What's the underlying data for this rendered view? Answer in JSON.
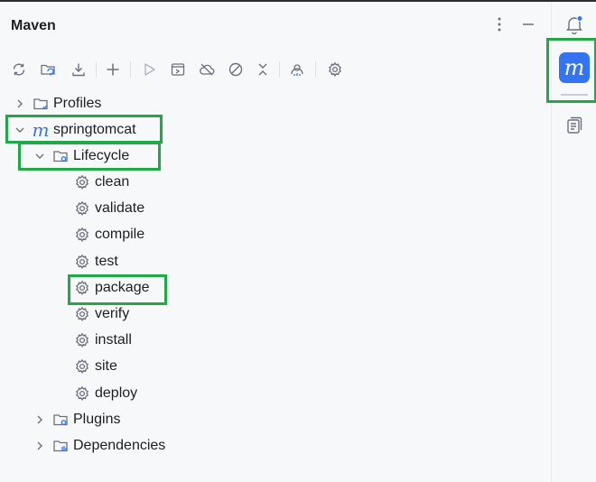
{
  "panel": {
    "title": "Maven",
    "options_icon": "more-vertical-icon",
    "minimize_icon": "minimize-icon"
  },
  "toolbar": {
    "buttons": [
      {
        "name": "reload-all-projects",
        "icon": "sync-icon"
      },
      {
        "name": "generate-sources-and-update-folders",
        "icon": "folder-refresh-icon"
      },
      {
        "name": "download-sources",
        "icon": "download-icon"
      },
      {
        "name": "add-maven-projects",
        "icon": "plus-icon"
      },
      {
        "name": "run-maven-build",
        "icon": "play-icon"
      },
      {
        "name": "execute-maven-goal",
        "icon": "terminal-window-icon"
      },
      {
        "name": "toggle-offline-mode",
        "icon": "cloud-off-icon"
      },
      {
        "name": "skip-tests",
        "icon": "skip-icon"
      },
      {
        "name": "collapse-all",
        "icon": "collapse-icon"
      },
      {
        "name": "show-dependencies",
        "icon": "diagram-icon"
      },
      {
        "name": "build-tool-settings",
        "icon": "gear-icon"
      }
    ]
  },
  "tree": {
    "profiles": "Profiles",
    "project": "springtomcat",
    "lifecycle": "Lifecycle",
    "goals": [
      "clean",
      "validate",
      "compile",
      "test",
      "package",
      "verify",
      "install",
      "site",
      "deploy"
    ],
    "plugins": "Plugins",
    "dependencies": "Dependencies"
  },
  "rightbar": {
    "notifications_icon": "bell-icon",
    "maven_label": "m",
    "structure_icon": "document-icon"
  },
  "colors": {
    "highlight": "#22a846",
    "maven_blue": "#3574f0",
    "icon_gray": "#6c707e"
  }
}
